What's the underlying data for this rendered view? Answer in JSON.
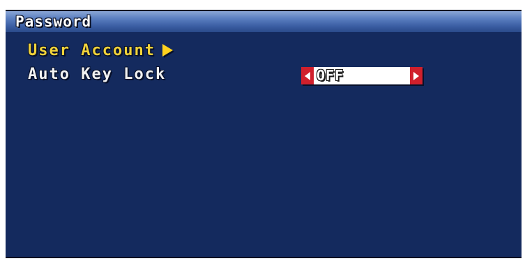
{
  "window": {
    "title": "Password"
  },
  "menu": {
    "items": [
      {
        "label": "User Account",
        "has_submenu": true,
        "selected": true
      },
      {
        "label": "Auto Key Lock",
        "value": "OFF"
      }
    ]
  },
  "colors": {
    "background": "#142a5e",
    "selected_text": "#f0d23a",
    "normal_text": "#f2f2f2",
    "spinner_arrow_bg": "#d0202c"
  },
  "icons": {
    "submenu": "arrow-right-icon",
    "decrease": "arrow-left-icon",
    "increase": "arrow-right-icon"
  }
}
